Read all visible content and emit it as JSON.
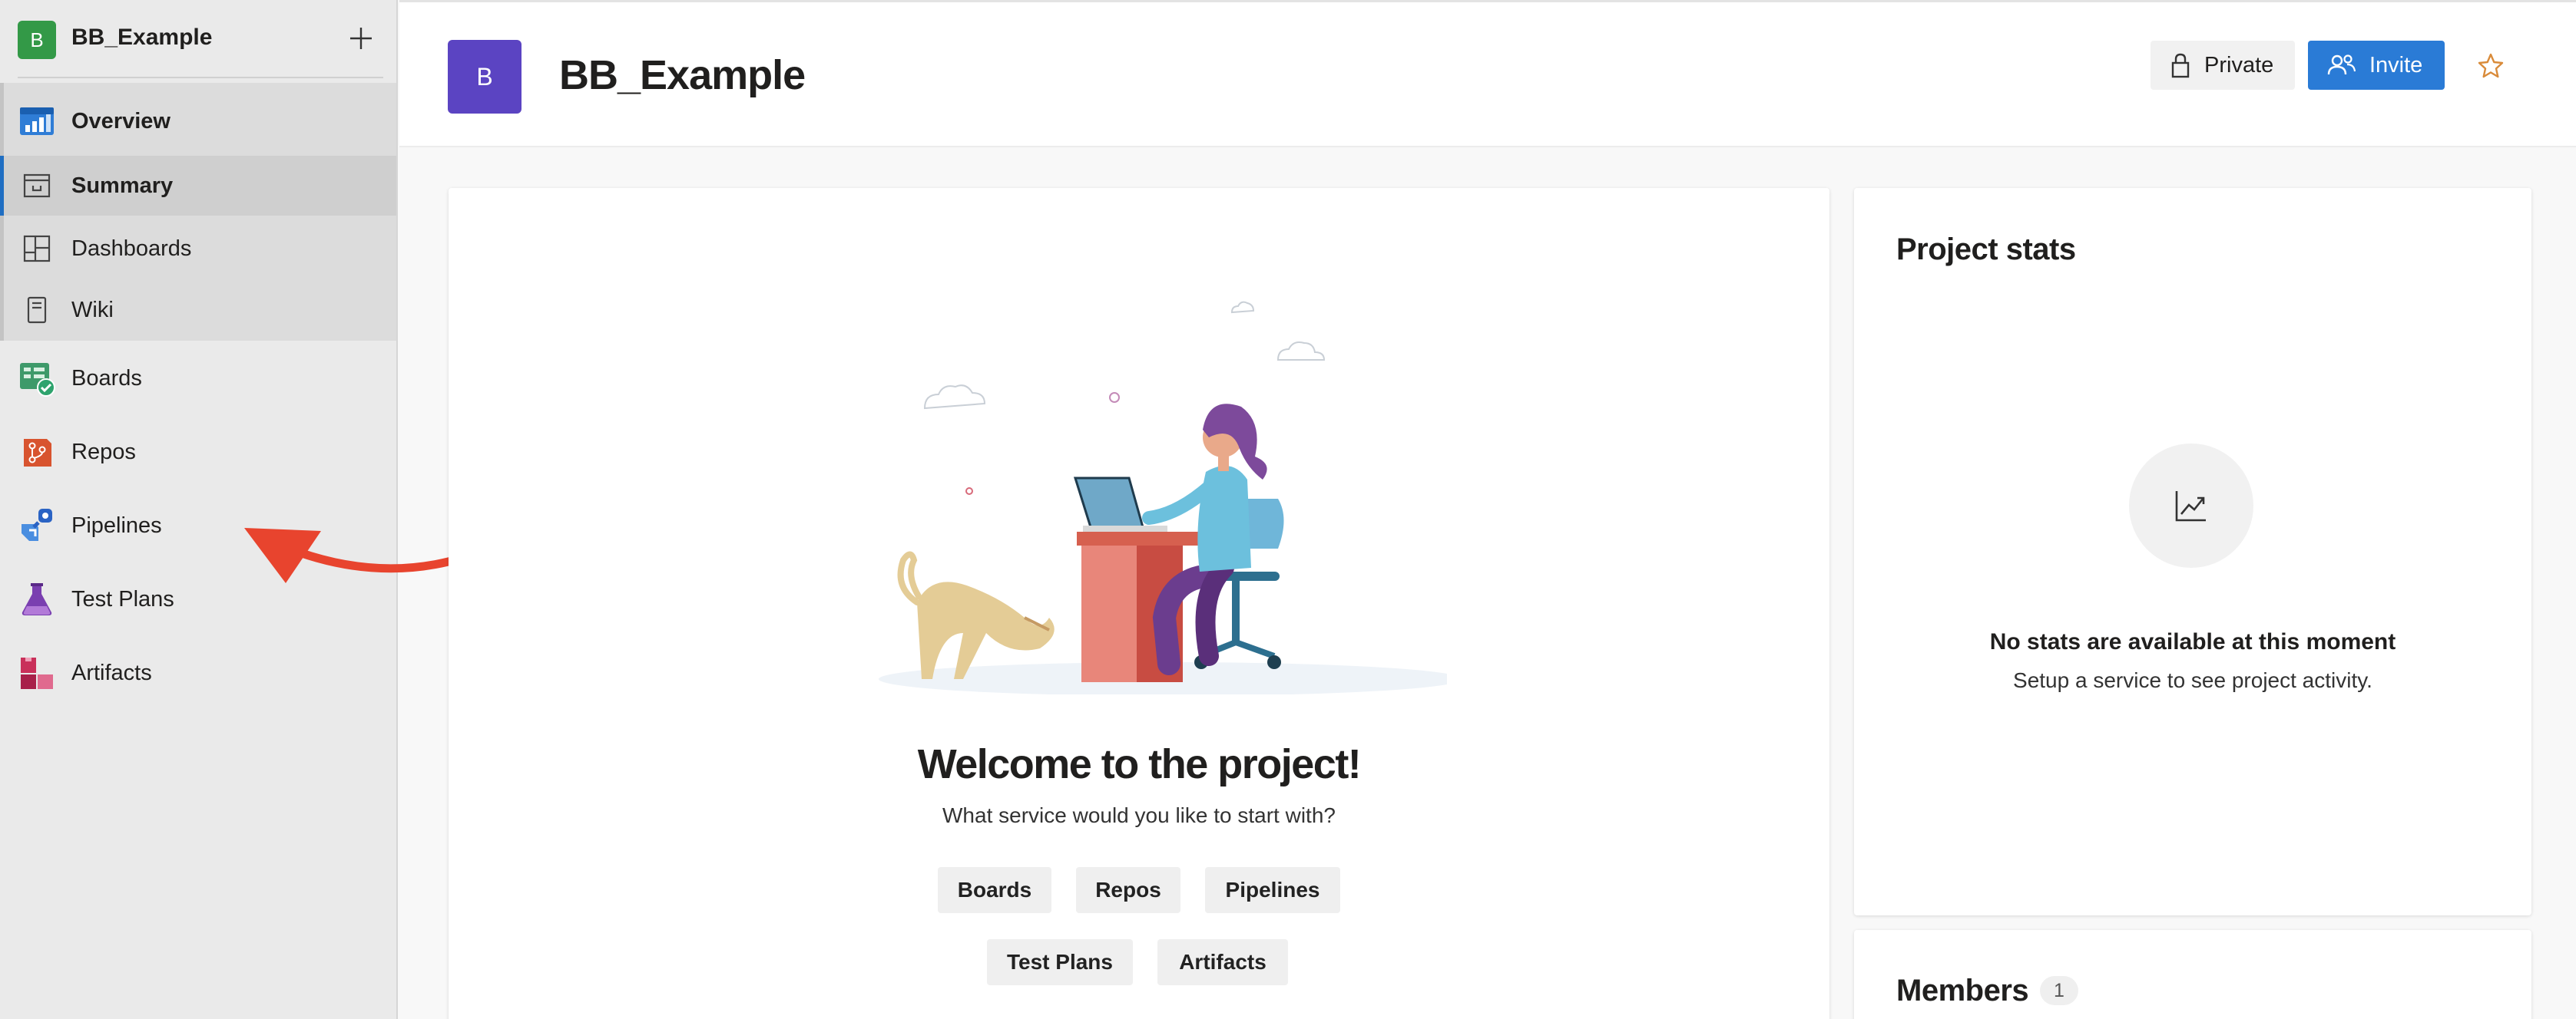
{
  "sidebar": {
    "project_name": "BB_Example",
    "project_initial": "B",
    "add_icon": "plus-icon",
    "items": [
      {
        "label": "Overview",
        "icon": "overview-icon"
      },
      {
        "label": "Summary",
        "icon": "summary-icon"
      },
      {
        "label": "Dashboards",
        "icon": "dashboards-icon"
      },
      {
        "label": "Wiki",
        "icon": "wiki-icon"
      },
      {
        "label": "Boards",
        "icon": "boards-icon"
      },
      {
        "label": "Repos",
        "icon": "repos-icon"
      },
      {
        "label": "Pipelines",
        "icon": "pipelines-icon"
      },
      {
        "label": "Test Plans",
        "icon": "test-plans-icon"
      },
      {
        "label": "Artifacts",
        "icon": "artifacts-icon"
      }
    ]
  },
  "header": {
    "project_initial": "B",
    "title": "BB_Example",
    "private_label": "Private",
    "invite_label": "Invite",
    "star_icon": "star-icon"
  },
  "welcome": {
    "title": "Welcome to the project!",
    "subtitle": "What service would you like to start with?",
    "services": [
      "Boards",
      "Repos",
      "Pipelines",
      "Test Plans",
      "Artifacts"
    ]
  },
  "stats": {
    "title": "Project stats",
    "empty_title": "No stats are available at this moment",
    "empty_subtitle": "Setup a service to see project activity."
  },
  "members": {
    "title": "Members",
    "count": "1"
  },
  "colors": {
    "invite_blue": "#2a7bd6",
    "project_avatar_purple": "#5b44c2",
    "sidebar_avatar_green": "#339947",
    "annotation_arrow": "#e8442e"
  }
}
